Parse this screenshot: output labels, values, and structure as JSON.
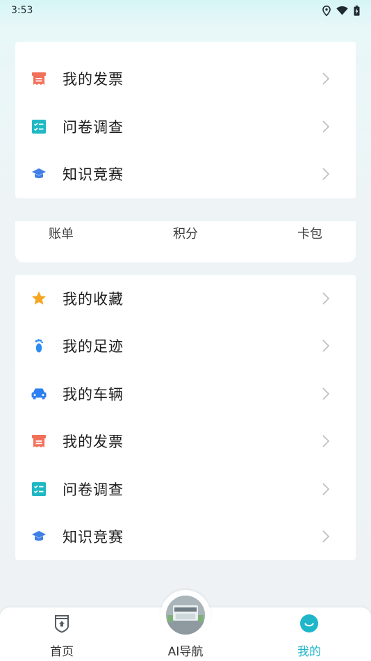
{
  "status": {
    "time": "3:53"
  },
  "top_card": {
    "items": [
      {
        "label": "我的发票",
        "icon": "invoice-icon"
      },
      {
        "label": "问卷调查",
        "icon": "survey-icon"
      },
      {
        "label": "知识竞赛",
        "icon": "graduation-cap-icon"
      }
    ]
  },
  "mid_card": {
    "items": [
      {
        "label": "账单"
      },
      {
        "label": "积分"
      },
      {
        "label": "卡包"
      }
    ]
  },
  "bottom_card": {
    "items": [
      {
        "label": "我的收藏",
        "icon": "star-icon"
      },
      {
        "label": "我的足迹",
        "icon": "footprint-icon"
      },
      {
        "label": "我的车辆",
        "icon": "car-icon"
      },
      {
        "label": "我的发票",
        "icon": "invoice-icon"
      },
      {
        "label": "问卷调查",
        "icon": "survey-icon"
      },
      {
        "label": "知识竞赛",
        "icon": "graduation-cap-icon"
      }
    ]
  },
  "tabbar": {
    "tabs": [
      {
        "label": "首页",
        "icon": "home-shield-icon"
      },
      {
        "label": "AI导航",
        "icon": "ai-nav-avatar"
      },
      {
        "label": "我的",
        "icon": "profile-smile-icon",
        "active": true
      }
    ]
  },
  "colors": {
    "accent": "#1fb6c9",
    "invoice": "#f2705a",
    "survey": "#1fb8c4",
    "cap": "#3f7fe6",
    "star": "#f5a623",
    "foot": "#2c8cf0",
    "car": "#2c7ff0"
  }
}
